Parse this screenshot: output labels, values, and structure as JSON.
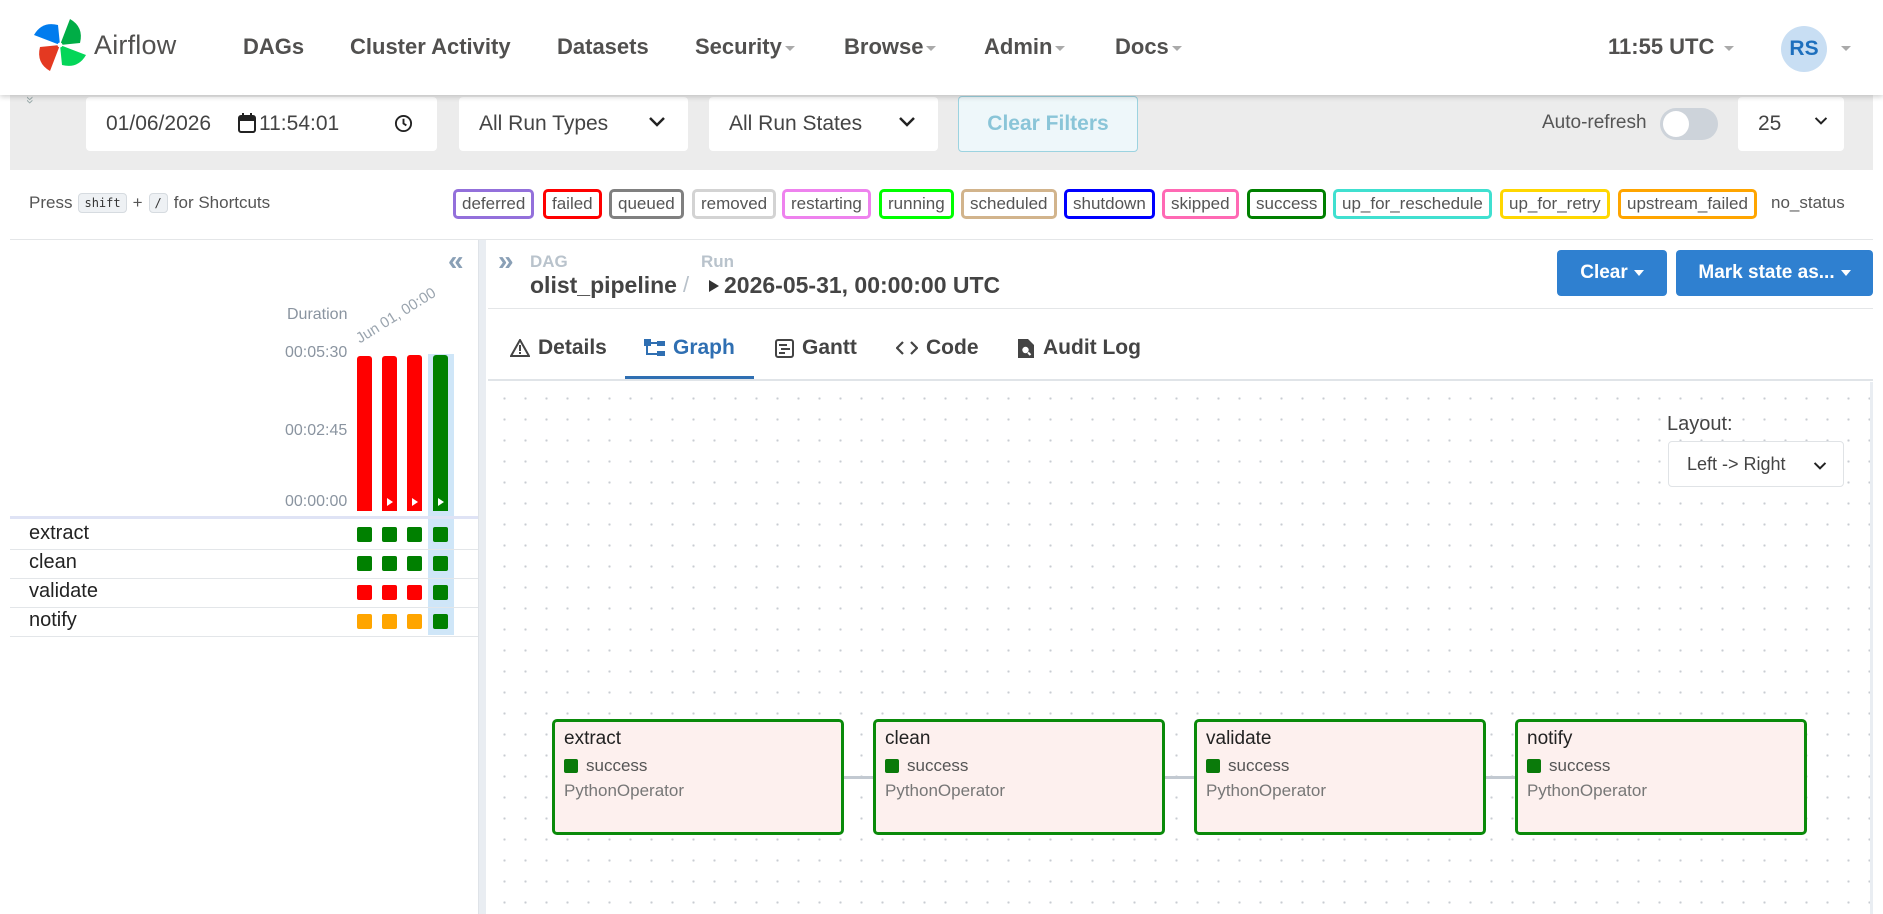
{
  "app": {
    "title": "Airflow"
  },
  "nav": {
    "items": [
      "DAGs",
      "Cluster Activity",
      "Datasets",
      "Security",
      "Browse",
      "Admin",
      "Docs"
    ],
    "time": "11:55 UTC",
    "user_initials": "RS"
  },
  "filters": {
    "date": "01/06/2026",
    "time": "11:54:01",
    "run_types": "All Run Types",
    "run_states": "All Run States",
    "clear": "Clear Filters",
    "auto_refresh_label": "Auto-refresh",
    "auto_refresh_on": false,
    "page_size": "25"
  },
  "shortcuts": {
    "press": "Press",
    "key1": "shift",
    "plus": "+",
    "key2": "/",
    "suffix": "for Shortcuts"
  },
  "legend": [
    {
      "label": "deferred",
      "color": "#9370db"
    },
    {
      "label": "failed",
      "color": "#ff0000"
    },
    {
      "label": "queued",
      "color": "#808080"
    },
    {
      "label": "removed",
      "color": "#d3d3d3"
    },
    {
      "label": "restarting",
      "color": "#ee82ee"
    },
    {
      "label": "running",
      "color": "#00ff00"
    },
    {
      "label": "scheduled",
      "color": "#d2b48c"
    },
    {
      "label": "shutdown",
      "color": "#0000ff"
    },
    {
      "label": "skipped",
      "color": "#ff69b4"
    },
    {
      "label": "success",
      "color": "#008000"
    },
    {
      "label": "up_for_reschedule",
      "color": "#40e0d0"
    },
    {
      "label": "up_for_retry",
      "color": "#ffd700"
    },
    {
      "label": "upstream_failed",
      "color": "#ffa500"
    },
    {
      "label": "no_status",
      "color": ""
    }
  ],
  "grid": {
    "duration_label": "Duration",
    "run_date_label": "Jun 01, 00:00",
    "y_ticks": [
      "00:05:30",
      "00:02:45",
      "00:00:00"
    ],
    "run_durations_fraction": [
      0.98,
      0.98,
      0.99,
      0.99
    ],
    "run_states": [
      "failed",
      "failed",
      "failed",
      "success"
    ],
    "tasks": [
      {
        "name": "extract",
        "states": [
          "success",
          "success",
          "success",
          "success"
        ]
      },
      {
        "name": "clean",
        "states": [
          "success",
          "success",
          "success",
          "success"
        ]
      },
      {
        "name": "validate",
        "states": [
          "failed",
          "failed",
          "failed",
          "success"
        ]
      },
      {
        "name": "notify",
        "states": [
          "upstream_failed",
          "upstream_failed",
          "upstream_failed",
          "success"
        ]
      }
    ]
  },
  "breadcrumb": {
    "dag_label": "DAG",
    "dag_id": "olist_pipeline",
    "separator": "/",
    "run_label": "Run",
    "run_id": "2026-05-31, 00:00:00 UTC"
  },
  "actions": {
    "clear": "Clear",
    "mark_state": "Mark state as..."
  },
  "tabs": [
    "Details",
    "Graph",
    "Gantt",
    "Code",
    "Audit Log"
  ],
  "active_tab": "Graph",
  "graph": {
    "layout_label": "Layout:",
    "layout_value": "Left -> Right",
    "nodes": [
      {
        "name": "extract",
        "state": "success",
        "operator": "PythonOperator"
      },
      {
        "name": "clean",
        "state": "success",
        "operator": "PythonOperator"
      },
      {
        "name": "validate",
        "state": "success",
        "operator": "PythonOperator"
      },
      {
        "name": "notify",
        "state": "success",
        "operator": "PythonOperator"
      }
    ]
  }
}
